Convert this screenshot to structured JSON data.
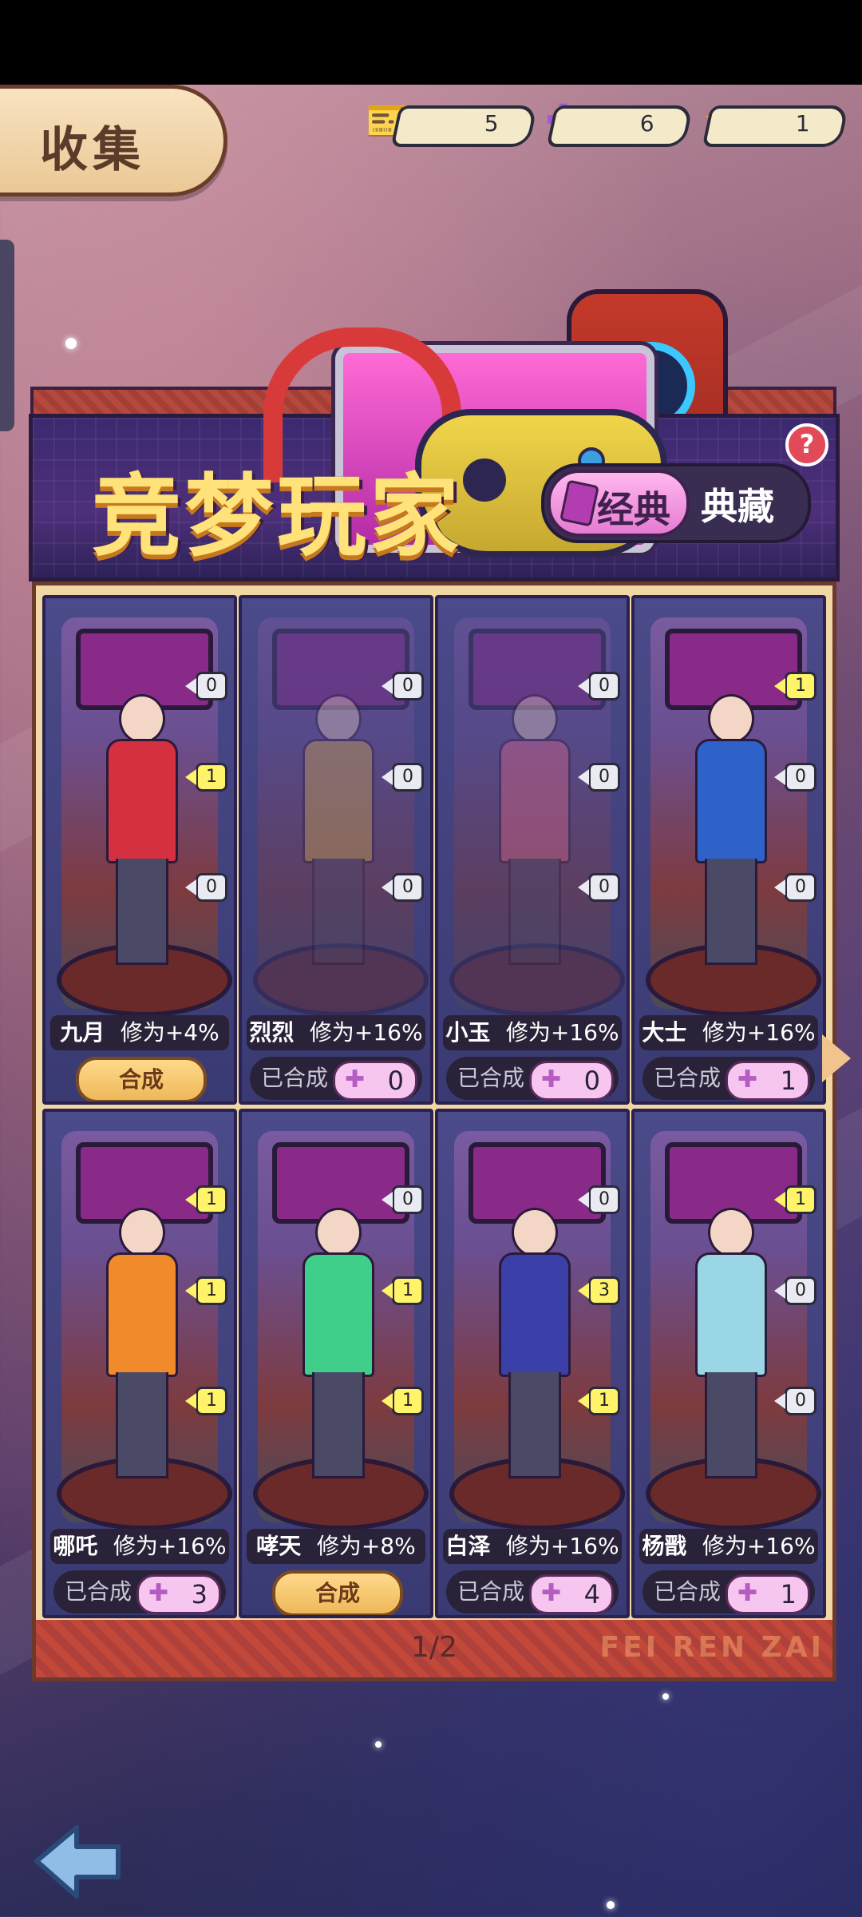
{
  "header": {
    "title": "收集"
  },
  "currencies": [
    {
      "icon": "ticket-icon",
      "value": "5"
    },
    {
      "icon": "puzzle-piece-icon",
      "value": "6"
    },
    {
      "icon": "star-puzzle-icon",
      "value": "1"
    }
  ],
  "banner": {
    "title": "竞梦玩家",
    "tabs": [
      {
        "label": "经典",
        "active": true
      },
      {
        "label": "典藏",
        "active": false
      }
    ],
    "help": "?"
  },
  "cards": [
    {
      "name": "九月",
      "bonus": "修为+4%",
      "counts": [
        "0",
        "1",
        "0"
      ],
      "action": "合成",
      "crafted": false,
      "owned": true,
      "color": "#d43040"
    },
    {
      "name": "烈烈",
      "bonus": "修为+16%",
      "counts": [
        "0",
        "0",
        "0"
      ],
      "action": "已合成",
      "fragments": "0",
      "crafted": true,
      "owned": false,
      "color": "#e0b34a"
    },
    {
      "name": "小玉",
      "bonus": "修为+16%",
      "counts": [
        "0",
        "0",
        "0"
      ],
      "action": "已合成",
      "fragments": "0",
      "crafted": true,
      "owned": false,
      "color": "#f06a8a"
    },
    {
      "name": "大士",
      "bonus": "修为+16%",
      "counts": [
        "1",
        "0",
        "0"
      ],
      "action": "已合成",
      "fragments": "1",
      "crafted": true,
      "owned": true,
      "color": "#2f62c8"
    },
    {
      "name": "哪吒",
      "bonus": "修为+16%",
      "counts": [
        "1",
        "1",
        "1"
      ],
      "action": "已合成",
      "fragments": "3",
      "crafted": true,
      "owned": true,
      "color": "#f08a2a"
    },
    {
      "name": "哮天",
      "bonus": "修为+8%",
      "counts": [
        "0",
        "1",
        "1"
      ],
      "action": "合成",
      "crafted": false,
      "owned": true,
      "color": "#3fcf8a"
    },
    {
      "name": "白泽",
      "bonus": "修为+16%",
      "counts": [
        "0",
        "3",
        "1"
      ],
      "action": "已合成",
      "fragments": "4",
      "crafted": true,
      "owned": true,
      "color": "#3b3fa8"
    },
    {
      "name": "杨戬",
      "bonus": "修为+16%",
      "counts": [
        "1",
        "0",
        "0"
      ],
      "action": "已合成",
      "fragments": "1",
      "crafted": true,
      "owned": true,
      "color": "#9ad6e6"
    }
  ],
  "pagination": {
    "label": "1/2"
  },
  "watermark": "FEI REN ZAI",
  "nav": {
    "back": "back-arrow-icon"
  }
}
